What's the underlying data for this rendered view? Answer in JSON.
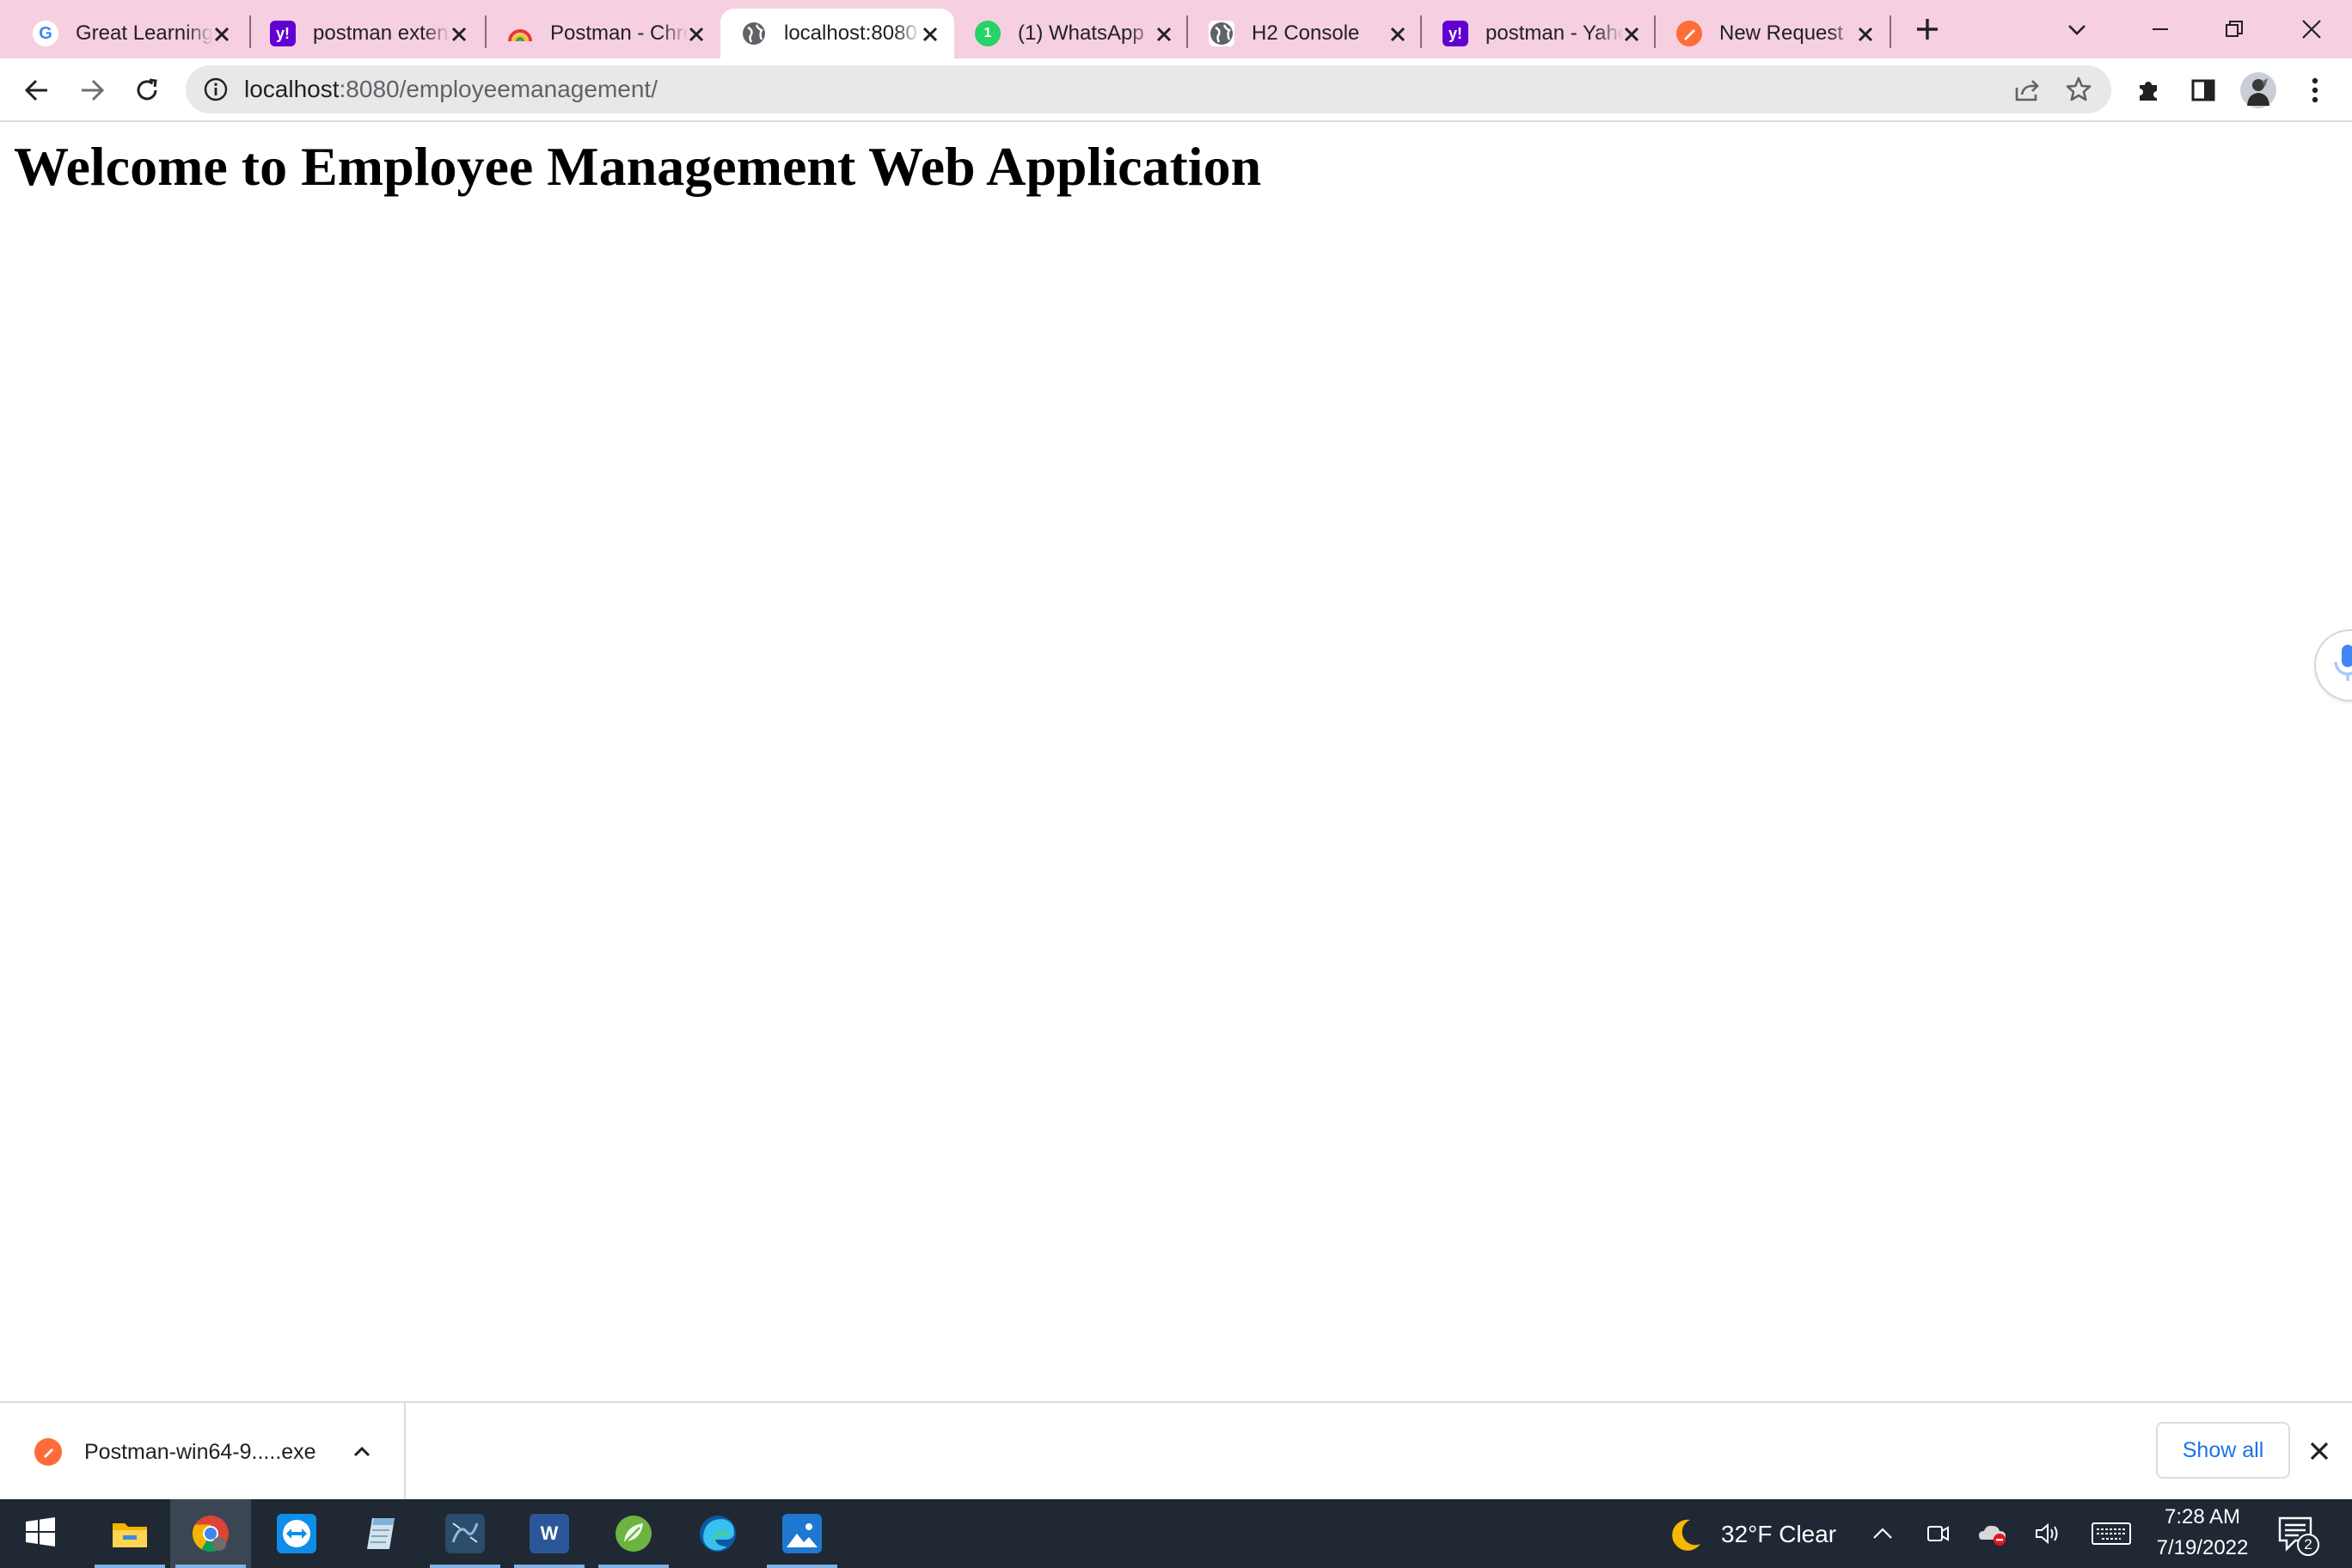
{
  "browser": {
    "tabs": [
      {
        "title": "Great Learning",
        "favicon": "google-icon",
        "active": false
      },
      {
        "title": "postman extension",
        "favicon": "yahoo-icon",
        "active": false
      },
      {
        "title": "Postman - Chrome",
        "favicon": "rainbow-icon",
        "active": false
      },
      {
        "title": "localhost:8080",
        "favicon": "globe-icon",
        "active": true
      },
      {
        "title": "(1) WhatsApp",
        "favicon": "whatsapp-icon",
        "active": false,
        "badge": "1"
      },
      {
        "title": "H2 Console",
        "favicon": "globe-icon",
        "active": false
      },
      {
        "title": "postman - Yahoo",
        "favicon": "yahoo-icon",
        "active": false
      },
      {
        "title": "New Request",
        "favicon": "postman-icon",
        "active": false
      }
    ],
    "address": {
      "host": "localhost",
      "path": ":8080/employeemanagement/"
    },
    "colors": {
      "tabstrip": "#f6cfe0",
      "omnibox": "#e8e8e8",
      "link_blue": "#1a73e8",
      "postman_orange": "#ff6c37",
      "yahoo_purple": "#6001d2",
      "whatsapp_green": "#25d366"
    }
  },
  "page": {
    "heading": "Welcome to Employee Management Web Application"
  },
  "download_shelf": {
    "file_name": "Postman-win64-9.....exe",
    "show_all_label": "Show all"
  },
  "taskbar": {
    "apps": [
      "start-icon",
      "file-explorer-icon",
      "chrome-icon",
      "teamviewer-icon",
      "notepad-icon",
      "mysql-workbench-icon",
      "word-icon",
      "spring-tool-suite-icon",
      "edge-icon",
      "photos-icon"
    ],
    "weather": "32°F  Clear",
    "time": "7:28 AM",
    "date": "7/19/2022",
    "notification_count": "2"
  }
}
